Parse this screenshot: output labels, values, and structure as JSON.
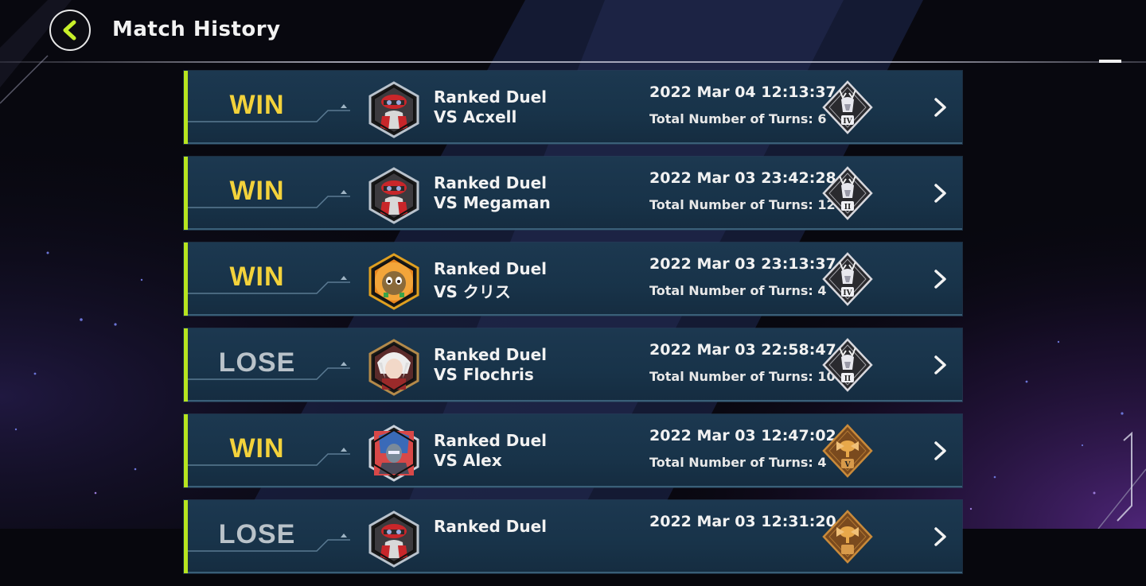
{
  "header": {
    "title": "Match History"
  },
  "colors": {
    "accent": "#b7e51f",
    "win": "#f3d23b",
    "lose": "#b9c2c9",
    "row_bg": "#1a3449"
  },
  "matches": [
    {
      "result": "WIN",
      "mode": "Ranked Duel",
      "opponent": "VS Acxell",
      "datetime": "2022 Mar 04 12:13:37",
      "turns_label": "Total Number of Turns: 6",
      "avatar": "red-cap-duelist",
      "rank_icon": "silver-stag-rank-icon",
      "rank_numeral": "IV"
    },
    {
      "result": "WIN",
      "mode": "Ranked Duel",
      "opponent": "VS Megaman",
      "datetime": "2022 Mar 03 23:42:28",
      "turns_label": "Total Number of Turns: 12",
      "avatar": "red-cap-duelist",
      "rank_icon": "silver-stag-rank-icon",
      "rank_numeral": "II"
    },
    {
      "result": "WIN",
      "mode": "Ranked Duel",
      "opponent": "VS クリス",
      "datetime": "2022 Mar 03 23:13:37",
      "turns_label": "Total Number of Turns: 4",
      "avatar": "kuriboh",
      "rank_icon": "silver-stag-rank-icon",
      "rank_numeral": "IV"
    },
    {
      "result": "LOSE",
      "mode": "Ranked Duel",
      "opponent": "VS Flochris",
      "datetime": "2022 Mar 03 22:58:47",
      "turns_label": "Total Number of Turns: 10",
      "avatar": "white-hair-duelist",
      "rank_icon": "silver-stag-rank-icon",
      "rank_numeral": "II"
    },
    {
      "result": "WIN",
      "mode": "Ranked Duel",
      "opponent": "VS Alex",
      "datetime": "2022 Mar 03 12:47:02",
      "turns_label": "Total Number of Turns: 4",
      "avatar": "armored-warrior",
      "rank_icon": "bronze-wasp-rank-icon",
      "rank_numeral": "V"
    },
    {
      "result": "LOSE",
      "mode": "Ranked Duel",
      "opponent": "",
      "datetime": "2022 Mar 03 12:31:20",
      "turns_label": "",
      "avatar": "red-cap-duelist",
      "rank_icon": "bronze-wasp-rank-icon",
      "rank_numeral": ""
    }
  ]
}
